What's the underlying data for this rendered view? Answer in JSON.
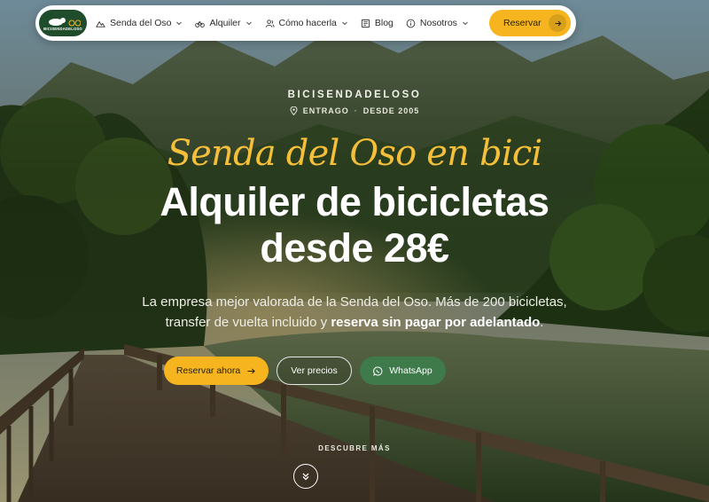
{
  "nav": {
    "logo_text": "BICISENDADELOSO",
    "items": [
      {
        "label": "Senda del Oso",
        "icon": "mountain-icon",
        "dropdown": true
      },
      {
        "label": "Alquiler",
        "icon": "bike-icon",
        "dropdown": true
      },
      {
        "label": "Cómo hacerla",
        "icon": "users-icon",
        "dropdown": true
      },
      {
        "label": "Blog",
        "icon": "newspaper-icon",
        "dropdown": false
      },
      {
        "label": "Nosotros",
        "icon": "info-icon",
        "dropdown": true
      }
    ],
    "cta_label": "Reservar"
  },
  "hero": {
    "brand": "BICISENDADELOSO",
    "location": "ENTRAGO",
    "since": "DESDE 2005",
    "script_title": "Senda del Oso en bici",
    "headline_line1": "Alquiler de bicicletas",
    "headline_line2": "desde 28€",
    "desc_part1": "La empresa mejor valorada de la Senda del Oso. Más de 200 bicicletas,",
    "desc_part2": "transfer de vuelta incluido y",
    "desc_bold": "reserva sin pagar por adelantado",
    "desc_end": "."
  },
  "buttons": {
    "primary": "Reservar ahora",
    "secondary": "Ver precios",
    "whatsapp": "WhatsApp"
  },
  "discover_label": "DESCUBRE MÁS",
  "colors": {
    "accent": "#f6b51f",
    "script": "#f5bf3a",
    "whatsapp": "#3f7a4a",
    "logo_bg": "#1f4d2c"
  }
}
